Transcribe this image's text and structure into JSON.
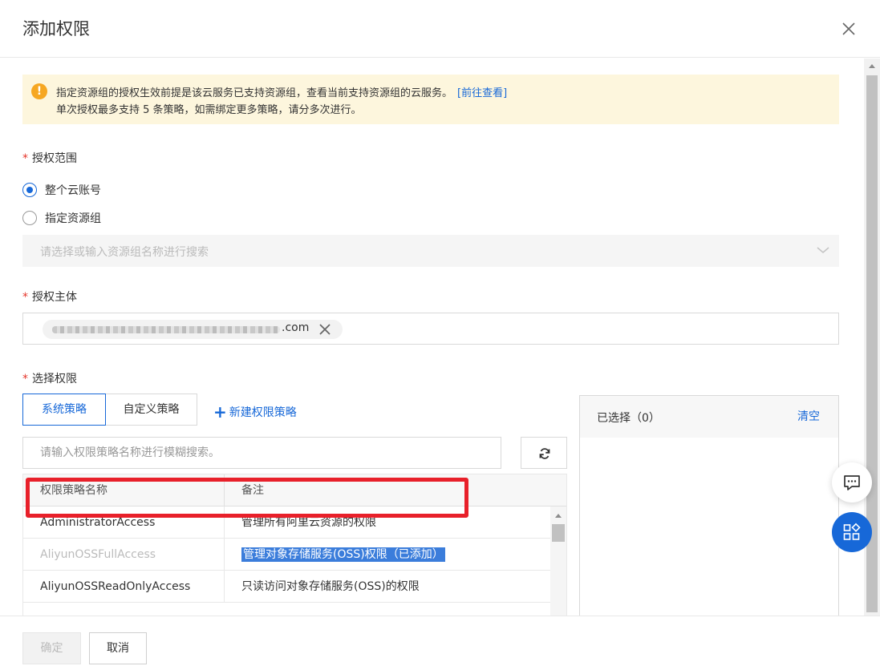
{
  "dialog": {
    "title": "添加权限"
  },
  "alert": {
    "line1": "指定资源组的授权生效前提是该云服务已支持资源组，查看当前支持资源组的云服务。",
    "link": "[前往查看]",
    "line2": "单次授权最多支持 5 条策略，如需绑定更多策略，请分多次进行。"
  },
  "scope": {
    "label": "授权范围",
    "options": [
      "整个云账号",
      "指定资源组"
    ],
    "selected_index": 0,
    "resource_group_placeholder": "请选择或输入资源组名称进行搜索"
  },
  "principal": {
    "label": "授权主体",
    "value_suffix": ".com"
  },
  "permissions": {
    "label": "选择权限",
    "tabs": [
      "系统策略",
      "自定义策略"
    ],
    "active_tab_index": 0,
    "new_policy": "新建权限策略",
    "search_placeholder": "请输入权限策略名称进行模糊搜索。",
    "table": {
      "headers": [
        "权限策略名称",
        "备注"
      ],
      "rows": [
        {
          "name": "AdministratorAccess",
          "note": "管理所有阿里云资源的权限"
        },
        {
          "name": "AliyunOSSFullAccess",
          "note": "管理对象存储服务(OSS)权限（已添加）"
        },
        {
          "name": "AliyunOSSReadOnlyAccess",
          "note": "只读访问对象存储服务(OSS)的权限"
        }
      ]
    }
  },
  "selected": {
    "title": "已选择（0）",
    "clear": "清空"
  },
  "footer": {
    "ok": "确定",
    "cancel": "取消"
  },
  "colors": {
    "accent": "#1768d8",
    "alert_bg": "#fdf6dd",
    "warning_icon": "#f6a722",
    "required_star": "#e5352b",
    "annotation_red": "#e8202a",
    "highlight": "#3b7ddb"
  }
}
